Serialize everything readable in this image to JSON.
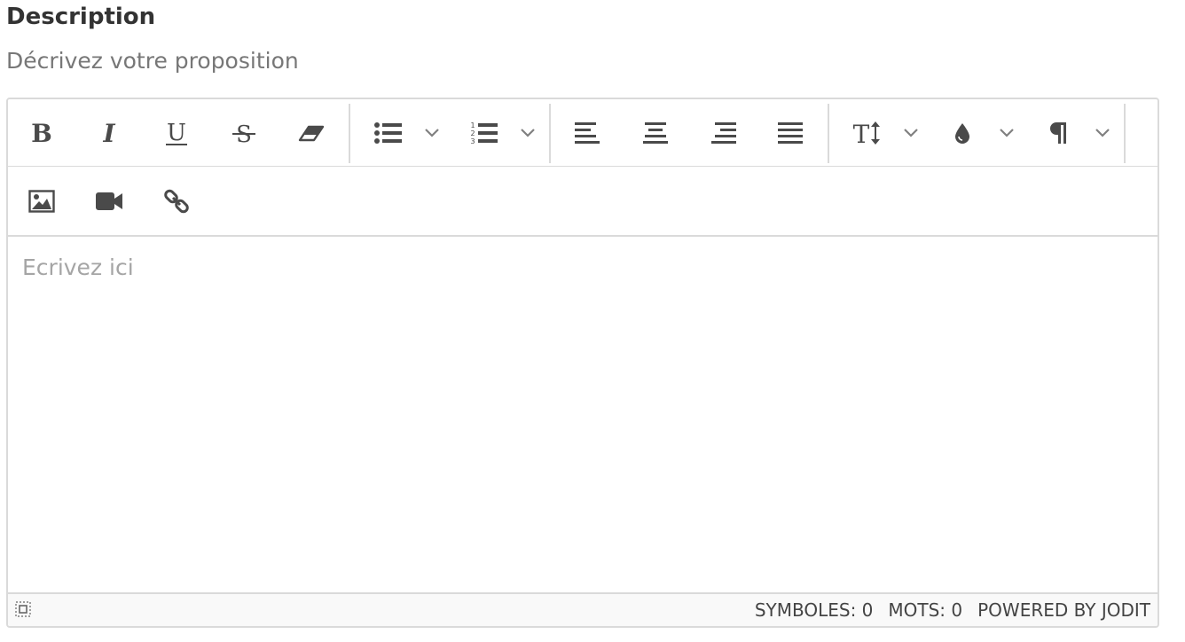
{
  "field": {
    "label": "Description",
    "hint": "Décrivez votre proposition"
  },
  "toolbar": {
    "row1": {
      "bold": "bold-icon",
      "italic": "italic-icon",
      "underline": "underline-icon",
      "strikethrough": "strikethrough-icon",
      "eraser": "eraser-icon",
      "ul": "unordered-list-icon",
      "ol": "ordered-list-icon",
      "align_left": "align-left-icon",
      "align_center": "align-center-icon",
      "align_right": "align-right-icon",
      "align_justify": "align-justify-icon",
      "font_size": "font-size-icon",
      "brush": "color-drop-icon",
      "paragraph": "paragraph-icon"
    },
    "row2": {
      "image": "image-icon",
      "video": "video-icon",
      "link": "link-icon"
    }
  },
  "editor": {
    "placeholder": "Ecrivez ici"
  },
  "statusbar": {
    "symbols": "SYMBOLES: 0",
    "words": "MOTS: 0",
    "powered": "POWERED BY JODIT"
  },
  "colors": {
    "icon": "#4a4a4a",
    "border": "#dadada",
    "caret": "#808080",
    "placeholder": "#a5a5a5"
  }
}
